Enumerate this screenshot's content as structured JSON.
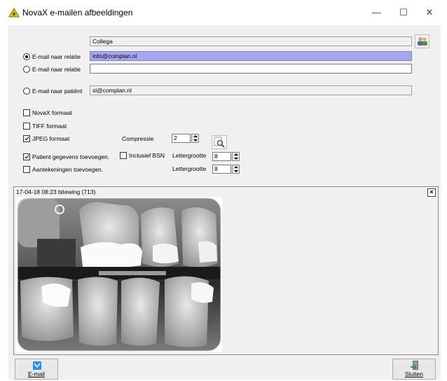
{
  "window": {
    "title": "NovaX e-mailen afbeeldingen",
    "minimize_glyph": "—",
    "maximize_glyph": "☐",
    "close_glyph": "✕"
  },
  "recipient": {
    "name_value": "Collega"
  },
  "email_options": [
    {
      "label": "E-mail naar relatie",
      "value": "info@complan.nl",
      "selected": true
    },
    {
      "label": "E-mail naar relatie",
      "value": "",
      "selected": false
    },
    {
      "label": "E-mail naar patiënt",
      "value": "sl@complan.nl",
      "selected": false
    }
  ],
  "formats": {
    "novax": {
      "label": "NovaX formaat",
      "checked": false
    },
    "tiff": {
      "label": "TIFF formaat",
      "checked": false
    },
    "jpeg": {
      "label": "JPEG formaat",
      "checked": true
    },
    "compression_label": "Compressie",
    "compression_value": "2"
  },
  "patient": {
    "label": "Patient gegevens toevoegen.",
    "checked": true,
    "bsn_label": "Inclusief BSN",
    "bsn_checked": false,
    "fontsize_label": "Lettergrootte",
    "fontsize_value": "8"
  },
  "notes": {
    "label": "Aantekeningen toevoegen.",
    "checked": false,
    "fontsize_label": "Lettergrootte",
    "fontsize_value": "8"
  },
  "image_panel": {
    "title": "17-04-18 08:23 bitewing (713)",
    "close_glyph": "×"
  },
  "buttons": {
    "email_label": "E-mail",
    "close_label": "Sluiten"
  },
  "colors": {
    "highlight": "#a6a6f5",
    "dialog_bg": "#f0f0f0",
    "email_icon": "#1e90ff"
  }
}
